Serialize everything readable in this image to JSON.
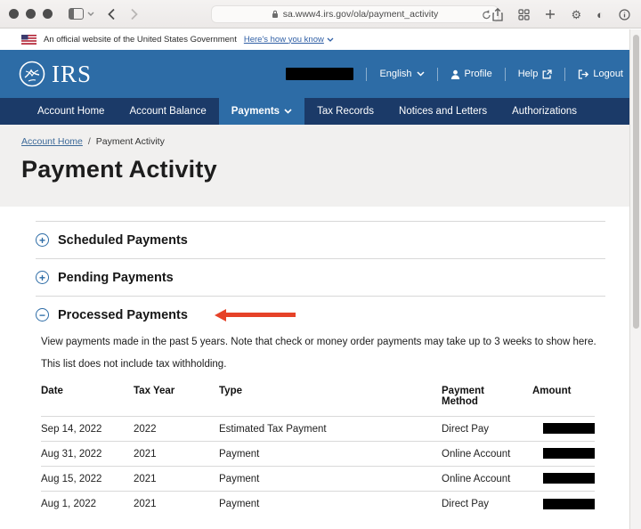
{
  "browser": {
    "url": "sa.www4.irs.gov/ola/payment_activity"
  },
  "gov_banner": {
    "text": "An official website of the United States Government",
    "link": "Here's how you know"
  },
  "header": {
    "logo_text": "IRS",
    "language": "English",
    "profile": "Profile",
    "help": "Help",
    "logout": "Logout"
  },
  "nav": {
    "items": [
      {
        "label": "Account Home",
        "active": false
      },
      {
        "label": "Account Balance",
        "active": false
      },
      {
        "label": "Payments",
        "active": true
      },
      {
        "label": "Tax Records",
        "active": false
      },
      {
        "label": "Notices and Letters",
        "active": false
      },
      {
        "label": "Authorizations",
        "active": false
      }
    ]
  },
  "breadcrumb": {
    "link": "Account Home",
    "separator": "/",
    "current": "Payment Activity"
  },
  "page": {
    "title": "Payment Activity"
  },
  "accordions": [
    {
      "label": "Scheduled Payments",
      "state": "collapsed",
      "icon": "+"
    },
    {
      "label": "Pending Payments",
      "state": "collapsed",
      "icon": "+"
    },
    {
      "label": "Processed Payments",
      "state": "expanded",
      "icon": "−",
      "annotated_with_red_arrow": true
    }
  ],
  "processed_section": {
    "note1": "View payments made in the past 5 years. Note that check or money order payments may take up to 3 weeks to show here.",
    "note2": "This list does not include tax withholding.",
    "table": {
      "headers": [
        "Date",
        "Tax Year",
        "Type",
        "Payment Method",
        "Amount"
      ],
      "rows": [
        {
          "date": "Sep 14, 2022",
          "tax_year": "2022",
          "type": "Estimated Tax Payment",
          "payment_method": "Direct Pay",
          "amount_redacted": true
        },
        {
          "date": "Aug 31, 2022",
          "tax_year": "2021",
          "type": "Payment",
          "payment_method": "Online Account",
          "amount_redacted": true
        },
        {
          "date": "Aug 15, 2022",
          "tax_year": "2021",
          "type": "Payment",
          "payment_method": "Online Account",
          "amount_redacted": true
        },
        {
          "date": "Aug 1, 2022",
          "tax_year": "2021",
          "type": "Payment",
          "payment_method": "Direct Pay",
          "amount_redacted": true
        }
      ]
    }
  },
  "colors": {
    "header_blue": "#2d6ca6",
    "nav_navy": "#1b3a68",
    "link_blue": "#2f5fa5",
    "annotation_red": "#e64228",
    "band_gray": "#f1f0ef",
    "redaction_black": "#000000"
  }
}
